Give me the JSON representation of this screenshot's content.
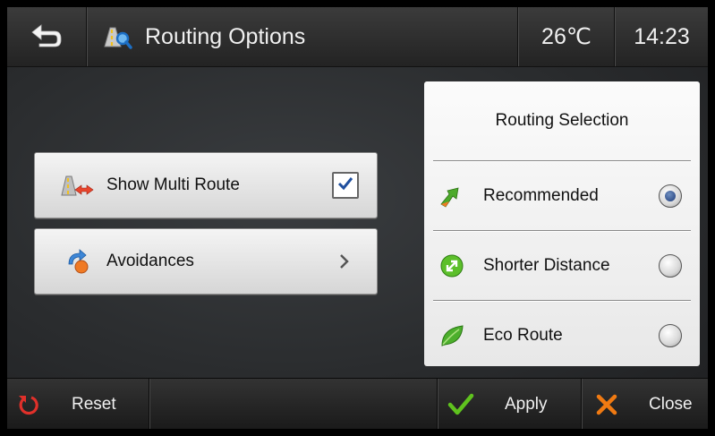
{
  "header": {
    "back_icon": "back-arrow-icon",
    "title_icon": "route-search-icon",
    "title": "Routing Options",
    "temperature": "26℃",
    "time": "14:23"
  },
  "options": {
    "multi_route": {
      "label": "Show Multi Route",
      "icon": "multi-route-icon",
      "checked": true
    },
    "avoidances": {
      "label": "Avoidances",
      "icon": "avoidances-icon"
    }
  },
  "routing": {
    "title": "Routing Selection",
    "items": [
      {
        "label": "Recommended",
        "icon": "recommended-route-icon",
        "selected": true
      },
      {
        "label": "Shorter Distance",
        "icon": "shorter-distance-icon",
        "selected": false
      },
      {
        "label": "Eco Route",
        "icon": "eco-leaf-icon",
        "selected": false
      }
    ]
  },
  "footer": {
    "reset": "Reset",
    "apply": "Apply",
    "close": "Close"
  },
  "colors": {
    "selected_radio": "#1d3a78",
    "apply_check": "#5fc21e",
    "close_x": "#f07a12",
    "reset_icon": "#e0302a"
  }
}
